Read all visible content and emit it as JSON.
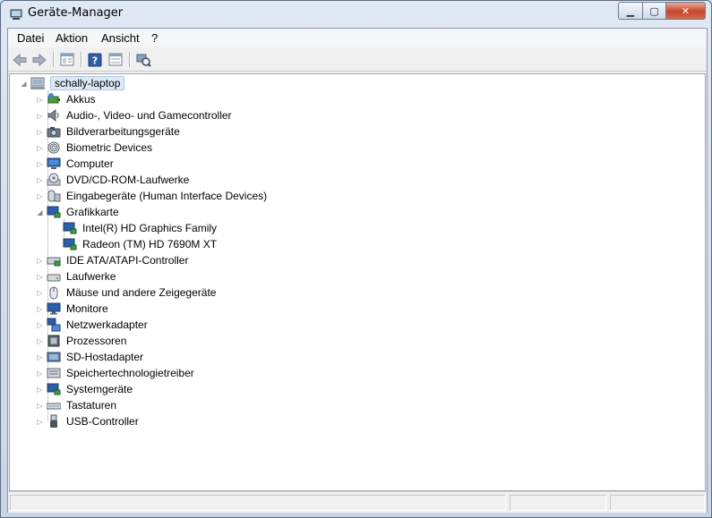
{
  "window": {
    "title": "Geräte-Manager"
  },
  "menu": [
    {
      "label": "Datei"
    },
    {
      "label": "Aktion"
    },
    {
      "label": "Ansicht"
    },
    {
      "label": "?"
    }
  ],
  "toolbar": {
    "buttons": [
      "back-icon",
      "forward-icon",
      "show-hide-tree-icon",
      "help-icon",
      "properties-icon",
      "scan-hardware-icon"
    ]
  },
  "tree": {
    "root": "schally-laptop",
    "categories": [
      {
        "label": "Akkus",
        "icon": "battery-icon"
      },
      {
        "label": "Audio-, Video- und Gamecontroller",
        "icon": "speaker-icon"
      },
      {
        "label": "Bildverarbeitungsgeräte",
        "icon": "camera-icon"
      },
      {
        "label": "Biometric Devices",
        "icon": "fingerprint-icon"
      },
      {
        "label": "Computer",
        "icon": "computer-icon"
      },
      {
        "label": "DVD/CD-ROM-Laufwerke",
        "icon": "disc-drive-icon"
      },
      {
        "label": "Eingabegeräte (Human Interface Devices)",
        "icon": "hid-icon"
      },
      {
        "label": "Grafikkarte",
        "icon": "display-adapter-icon",
        "expanded": true,
        "children": [
          "Intel(R) HD Graphics Family",
          "Radeon (TM) HD 7690M XT"
        ]
      },
      {
        "label": "IDE ATA/ATAPI-Controller",
        "icon": "ide-controller-icon"
      },
      {
        "label": "Laufwerke",
        "icon": "disk-drive-icon"
      },
      {
        "label": "Mäuse und andere Zeigegeräte",
        "icon": "mouse-icon"
      },
      {
        "label": "Monitore",
        "icon": "monitor-icon"
      },
      {
        "label": "Netzwerkadapter",
        "icon": "network-adapter-icon"
      },
      {
        "label": "Prozessoren",
        "icon": "processor-icon"
      },
      {
        "label": "SD-Hostadapter",
        "icon": "sd-host-icon"
      },
      {
        "label": "Speichertechnologietreiber",
        "icon": "storage-driver-icon"
      },
      {
        "label": "Systemgeräte",
        "icon": "system-device-icon"
      },
      {
        "label": "Tastaturen",
        "icon": "keyboard-icon"
      },
      {
        "label": "USB-Controller",
        "icon": "usb-icon"
      }
    ]
  },
  "status": {
    "text": ""
  }
}
